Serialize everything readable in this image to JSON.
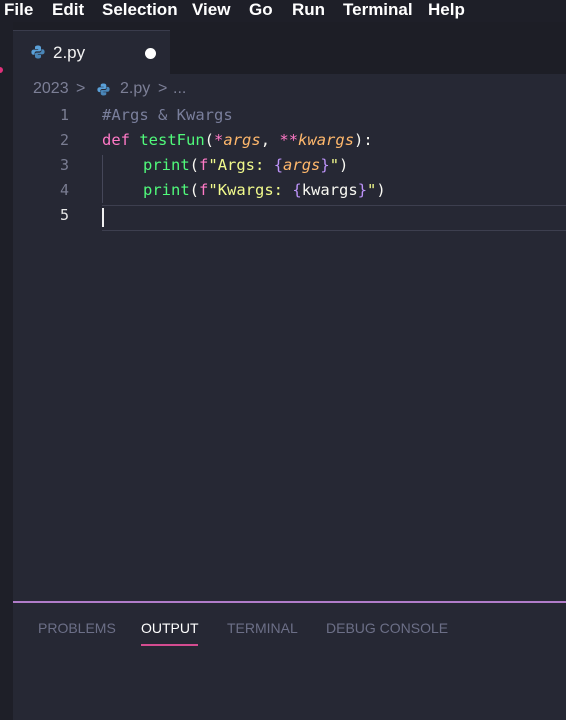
{
  "menu": {
    "items": [
      "File",
      "Edit",
      "Selection",
      "View",
      "Go",
      "Run",
      "Terminal",
      "Help"
    ]
  },
  "tab": {
    "filename": "2.py",
    "icon": "python-icon"
  },
  "breadcrumb": {
    "folder": "2023",
    "sep1": ">",
    "file": "2.py",
    "sep2": ">",
    "more": "..."
  },
  "editor": {
    "line_numbers": [
      "1",
      "2",
      "3",
      "4",
      "5"
    ],
    "line1": {
      "comment": "#Args & Kwargs"
    },
    "line2": {
      "kw": "def",
      "fn": "testFun",
      "open": "(",
      "star1": "*",
      "p1": "args",
      "comma": ", ",
      "star2": "**",
      "p2": "kwargs",
      "close": "):"
    },
    "line3": {
      "fn": "print",
      "open": "(",
      "prefix": "f",
      "str_start": "\"Args: ",
      "brace_open": "{",
      "var": "args",
      "brace_close": "}",
      "str_end": "\"",
      "close": ")"
    },
    "line4": {
      "fn": "print",
      "open": "(",
      "prefix": "f",
      "str_start": "\"Kwargs: ",
      "brace_open": "{",
      "var": "kwargs",
      "brace_close": "}",
      "str_end": "\"",
      "close": ")"
    }
  },
  "panel": {
    "tabs": [
      "PROBLEMS",
      "OUTPUT",
      "TERMINAL",
      "DEBUG CONSOLE"
    ],
    "active": "OUTPUT"
  },
  "colors": {
    "keyword": "#ff79c6",
    "function": "#50fa7b",
    "parameter": "#ffb86c",
    "string": "#f1fa8c",
    "brace": "#bd93f9",
    "comment": "#7a7f9c",
    "panel_border": "#b17cc9",
    "active_tab_underline": "#d44c90"
  }
}
